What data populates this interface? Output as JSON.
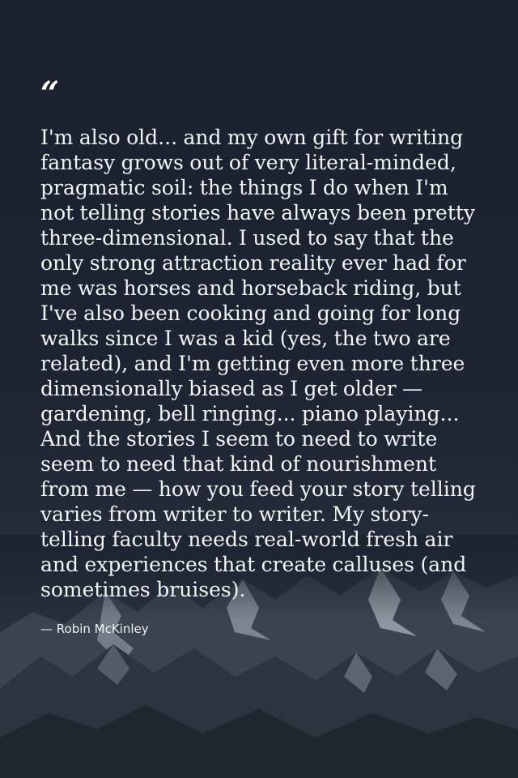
{
  "quote": {
    "mark": "“",
    "text": "I'm also old... and my own gift for writing fantasy grows out of very literal-minded, pragmatic soil: the things I do when I'm not telling stories have always been pretty three-dimensional. I used to say that the only strong attraction reality ever had for me was horses and horseback riding, but I've also been cooking and going for long walks since I was a kid (yes, the two are related), and I'm getting even more three dimensionally biased as I get older — gardening, bell ringing... piano playing... And the stories I seem to need to write seem to need that kind of nourishment from me — how you feed your story telling varies from writer to writer. My story-telling faculty needs real-world fresh air and experiences that create calluses (and sometimes bruises).",
    "author": "— Robin McKinley"
  },
  "colors": {
    "background": "#1b2430",
    "text": "#f4f4f4",
    "snow": "#c9cfd6"
  }
}
